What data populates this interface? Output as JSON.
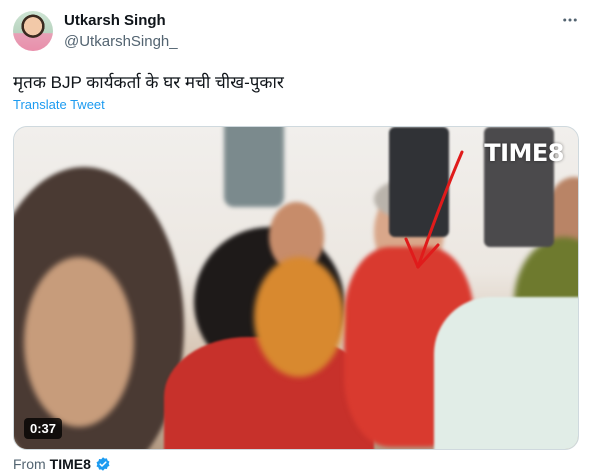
{
  "user": {
    "display_name": "Utkarsh Singh",
    "handle": "@UtkarshSingh_"
  },
  "tweet": {
    "text": "मृतक BJP कार्यकर्ता के घर मची चीख-पुकार",
    "translate_label": "Translate Tweet"
  },
  "media": {
    "duration": "0:37",
    "watermark": "TIME8"
  },
  "footer": {
    "from_label": "From",
    "source_name": "TIME8"
  },
  "icons": {
    "more": "more-horizontal-icon",
    "verified": "verified-badge-icon"
  },
  "colors": {
    "link": "#1d9bf0",
    "secondary_text": "#536471",
    "annotation_arrow": "#e01b1b"
  }
}
